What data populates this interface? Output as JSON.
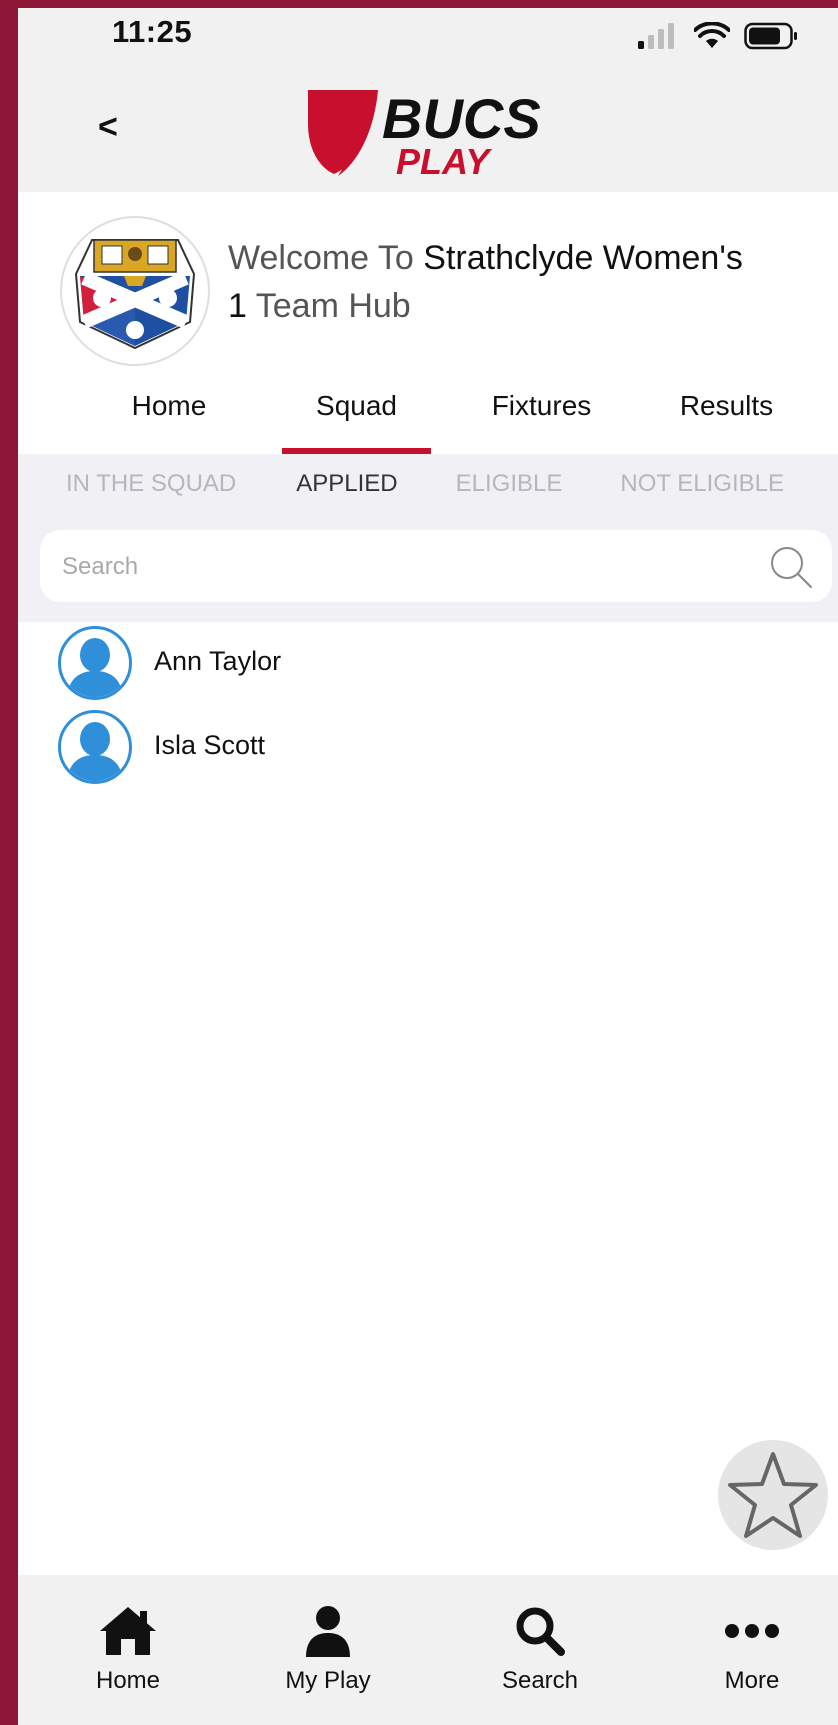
{
  "status_bar": {
    "time": "11:25"
  },
  "header": {
    "back_label": "<",
    "logo_text_top": "BUCS",
    "logo_text_bottom": "PLAY"
  },
  "team": {
    "welcome_prefix": "Welcome To ",
    "team_name": "Strathclyde Women's",
    "team_suffix_number": "1",
    "team_suffix": " Team Hub"
  },
  "main_tabs": [
    {
      "label": "Home"
    },
    {
      "label": "Squad"
    },
    {
      "label": "Fixtures"
    },
    {
      "label": "Results"
    }
  ],
  "sub_tabs": [
    {
      "label": "IN THE SQUAD"
    },
    {
      "label": "APPLIED"
    },
    {
      "label": "ELIGIBLE"
    },
    {
      "label": "NOT ELIGIBLE"
    }
  ],
  "search": {
    "placeholder": "Search"
  },
  "players": [
    {
      "name": "Ann Taylor"
    },
    {
      "name": "Isla Scott"
    }
  ],
  "bottom_nav": [
    {
      "label": "Home",
      "icon": "home-icon"
    },
    {
      "label": "My Play",
      "icon": "person-icon"
    },
    {
      "label": "Search",
      "icon": "search-icon"
    },
    {
      "label": "More",
      "icon": "more-icon"
    }
  ],
  "colors": {
    "brand_red": "#c8102e",
    "frame_maroon": "#8e1636",
    "avatar_blue": "#2f8fd8"
  }
}
